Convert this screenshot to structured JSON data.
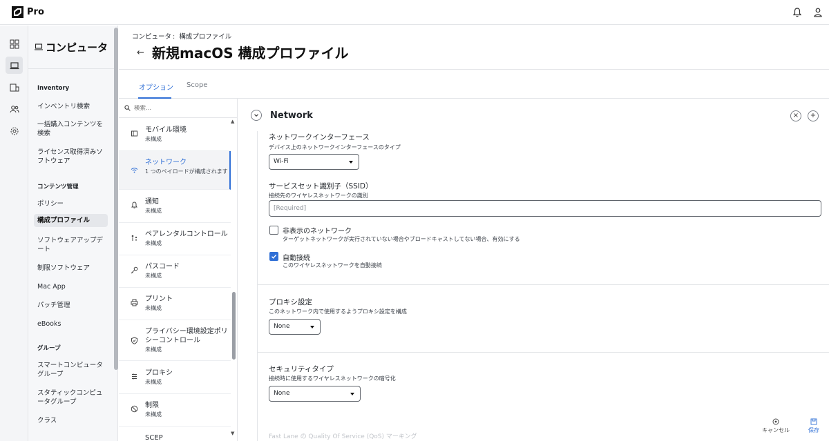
{
  "app": {
    "brand": "Pro",
    "colors": {
      "accent": "#2f6fd6",
      "rail_bg": "#f4f5f7",
      "sidebar_bg": "#f6f7f9"
    }
  },
  "topbar": {
    "icons": [
      "bell-icon",
      "user-icon"
    ]
  },
  "rail": {
    "icons": [
      "dashboard-icon",
      "computer-icon",
      "devices-icon",
      "users-icon",
      "settings-icon"
    ],
    "active": "computer-icon"
  },
  "sidebar": {
    "title": "コンピュータ",
    "sections": [
      {
        "label": "Inventory",
        "items": [
          "インベントリ検索",
          "一括購入コンテンツを検索",
          "ライセンス取得済みソフトウェア"
        ]
      },
      {
        "label": "コンテンツ管理",
        "items": [
          "ポリシー",
          "構成プロファイル",
          "ソフトウェアアップデート",
          "制限ソフトウェア",
          "Mac App",
          "パッチ管理",
          "eBooks"
        ]
      },
      {
        "label": "グループ",
        "items": [
          "スマートコンピュータグループ",
          "スタティックコンピュータグループ",
          "クラス"
        ]
      }
    ],
    "active_item": "構成プロファイル"
  },
  "header": {
    "breadcrumb": {
      "parent": "コンピュータ",
      "separator": ":",
      "current": "構成プロファイル"
    },
    "back": "←",
    "title": "新規macOS 構成プロファイル"
  },
  "tabs": [
    {
      "label": "オプション",
      "active": true
    },
    {
      "label": "Scope",
      "active": false
    }
  ],
  "payloads": {
    "search_placeholder": "検索...",
    "items": [
      {
        "name": "モバイル環境",
        "status": "未構成",
        "icon": "mobile-icon"
      },
      {
        "name": "ネットワーク",
        "status": "1 つのペイロードが構成されます",
        "icon": "wifi-icon",
        "active": true
      },
      {
        "name": "通知",
        "status": "未構成",
        "icon": "bell-icon"
      },
      {
        "name": "ペアレンタルコントロール",
        "status": "未構成",
        "icon": "family-icon"
      },
      {
        "name": "パスコード",
        "status": "未構成",
        "icon": "key-icon"
      },
      {
        "name": "プリント",
        "status": "未構成",
        "icon": "printer-icon"
      },
      {
        "name": "プライバシー環境設定ポリシーコントロール",
        "status": "未構成",
        "icon": "shield-icon"
      },
      {
        "name": "プロキシ",
        "status": "未構成",
        "icon": "proxy-icon"
      },
      {
        "name": "制限",
        "status": "未構成",
        "icon": "block-icon"
      },
      {
        "name": "SCEP",
        "status": "",
        "icon": "cert-icon"
      }
    ]
  },
  "network": {
    "title": "Network",
    "remove_label": "×",
    "add_label": "+",
    "interface": {
      "label": "ネットワークインターフェース",
      "help": "デバイス上のネットワークインターフェースのタイプ",
      "value": "Wi-Fi"
    },
    "ssid": {
      "label": "サービスセット識別子（SSID）",
      "help": "接続先のワイヤレスネットワークの識別",
      "placeholder": "[Required]"
    },
    "hidden": {
      "label": "非表示のネットワーク",
      "help": "ターゲットネットワークが実行されていない場合やブロードキャストしてない場合、有効にする",
      "checked": false
    },
    "autojoin": {
      "label": "自動接続",
      "help": "このワイヤレスネットワークを自動接続",
      "checked": true
    },
    "proxy": {
      "label": "プロキシ設定",
      "help": "このネットワーク内で使用するようプロキシ設定を構成",
      "value": "None"
    },
    "security": {
      "label": "セキュリティタイプ",
      "help": "接続時に使用するワイヤレスネットワークの暗号化",
      "value": "None"
    },
    "faded_next": "Fast Lane の Quality Of Service (QoS) マーキング"
  },
  "footer": {
    "cancel": "キャンセル",
    "save": "保存"
  }
}
